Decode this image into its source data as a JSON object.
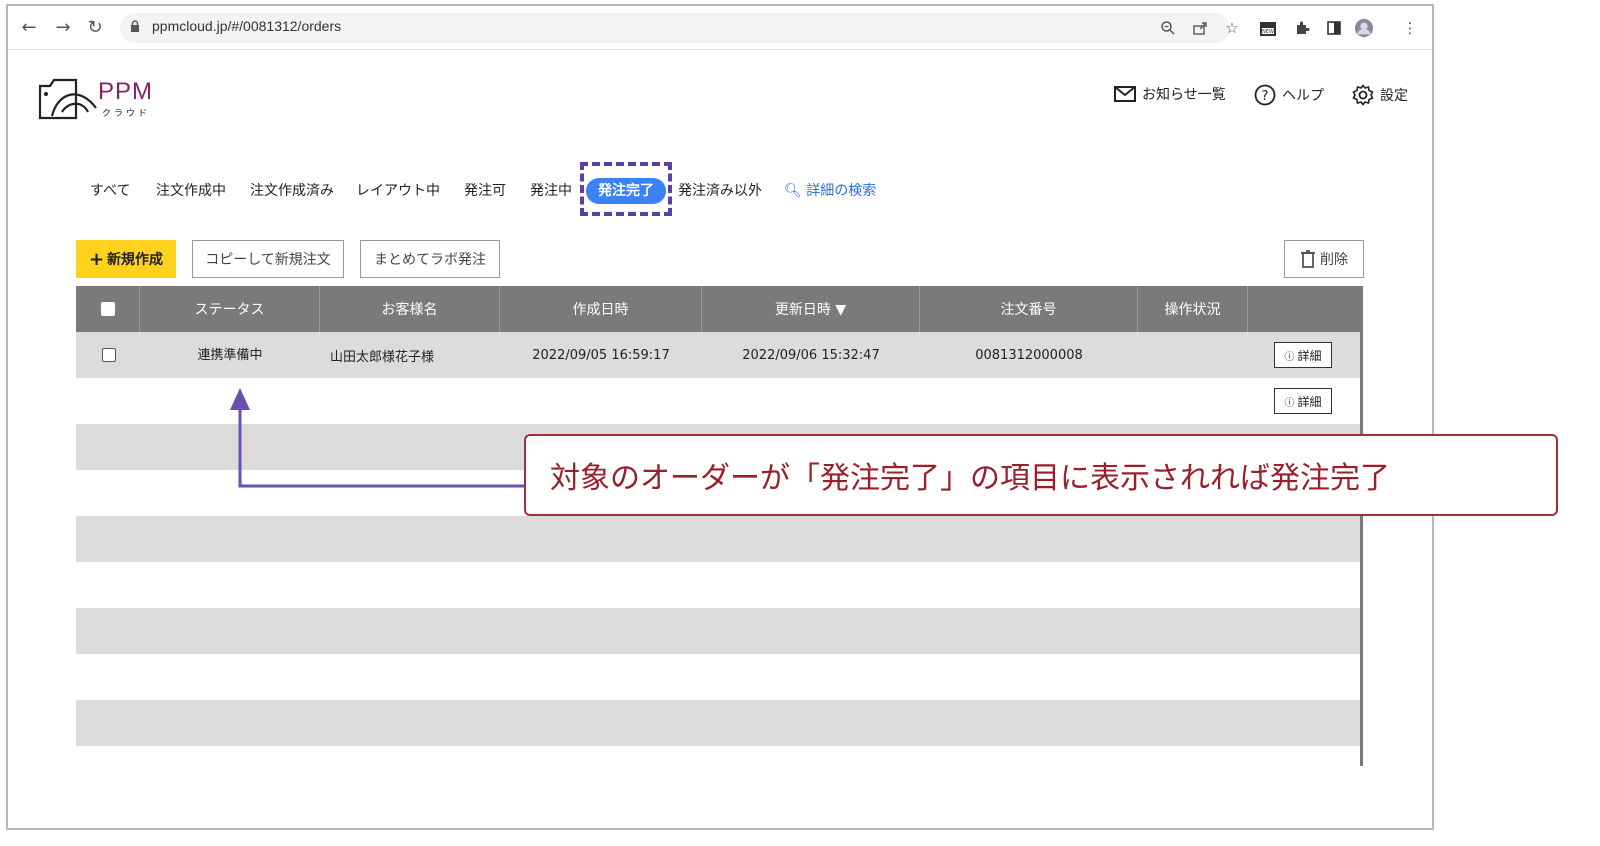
{
  "browser": {
    "url": "ppmcloud.jp/#/0081312/orders",
    "icons": [
      "back-icon",
      "forward-icon",
      "reload-icon",
      "lock-icon",
      "zoom-icon",
      "share-icon",
      "star-icon",
      "extension-new-icon",
      "puzzle-icon",
      "sidepanel-icon",
      "profile-avatar",
      "menu-dots-icon"
    ]
  },
  "header": {
    "logo_text": "PPM",
    "logo_sub": "クラウド",
    "notifications": "お知らせ一覧",
    "help": "ヘルプ",
    "settings": "設定"
  },
  "tabs": [
    {
      "label": "すべて"
    },
    {
      "label": "注文作成中"
    },
    {
      "label": "注文作成済み"
    },
    {
      "label": "レイアウト中"
    },
    {
      "label": "発注可"
    },
    {
      "label": "発注中"
    },
    {
      "label": "発注完了",
      "active": true
    },
    {
      "label": "発注済み以外"
    }
  ],
  "search_link": "詳細の検索",
  "toolbar": {
    "new_label": "新規作成",
    "copy_label": "コピーして新規注文",
    "bulk_label": "まとめてラボ発注",
    "delete_label": "削除"
  },
  "table": {
    "columns": [
      "ステータス",
      "お客様名",
      "作成日時",
      "更新日時 ▼",
      "注文番号",
      "操作状況"
    ],
    "rows": [
      {
        "status": "連携準備中",
        "customer": "山田太郎様花子様",
        "created": "2022/09/05 16:59:17",
        "updated": "2022/09/06 15:32:47",
        "order_no": "0081312000008",
        "operation": "",
        "detail_label": "詳細"
      }
    ],
    "second_detail_label": "詳細"
  },
  "callout": {
    "text": "対象のオーダーが「発注完了」の項目に表示されれば発注完了"
  },
  "colors": {
    "active_tab": "#3b82f6",
    "new_button": "#ffd21f",
    "header_row": "#7a7a7a",
    "highlight_dash": "#5b3fa8",
    "arrow": "#6a4fb0",
    "callout_border": "#a0303a"
  }
}
